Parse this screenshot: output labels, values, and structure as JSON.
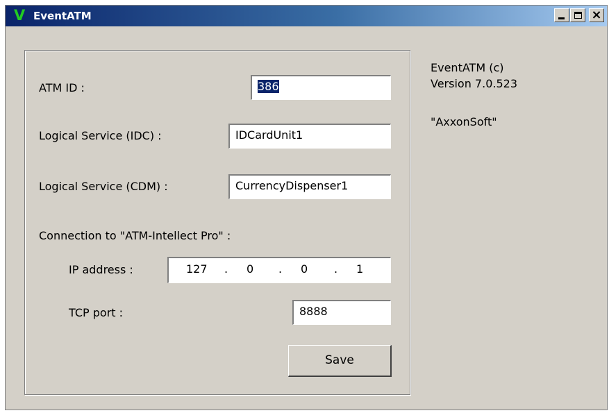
{
  "window": {
    "title": "EventATM",
    "logo": "V",
    "controls": {
      "minimize": "minimize-icon",
      "maximize": "maximize-icon",
      "close": "close-icon"
    }
  },
  "form": {
    "atm_id": {
      "label": "ATM ID :",
      "value": "386"
    },
    "idc": {
      "label": "Logical Service (IDC) :",
      "value": "IDCardUnit1"
    },
    "cdm": {
      "label": "Logical Service (CDM) :",
      "value": "CurrencyDispenser1"
    },
    "connection_label": "Connection to \"ATM-Intellect Pro\" :",
    "ip": {
      "label": "IP address :",
      "octets": [
        "127",
        "0",
        "0",
        "1"
      ]
    },
    "tcp": {
      "label": "TCP port :",
      "value": "8888"
    },
    "save_label": "Save"
  },
  "info": {
    "product": "EventATM (c)",
    "version": "Version 7.0.523",
    "company": "\"AxxonSoft\""
  },
  "colors": {
    "titlebar_start": "#0a246a",
    "titlebar_end": "#a6caf0",
    "window_bg": "#d4d0c8",
    "logo": "#22cc22",
    "selection": "#0a246a"
  }
}
